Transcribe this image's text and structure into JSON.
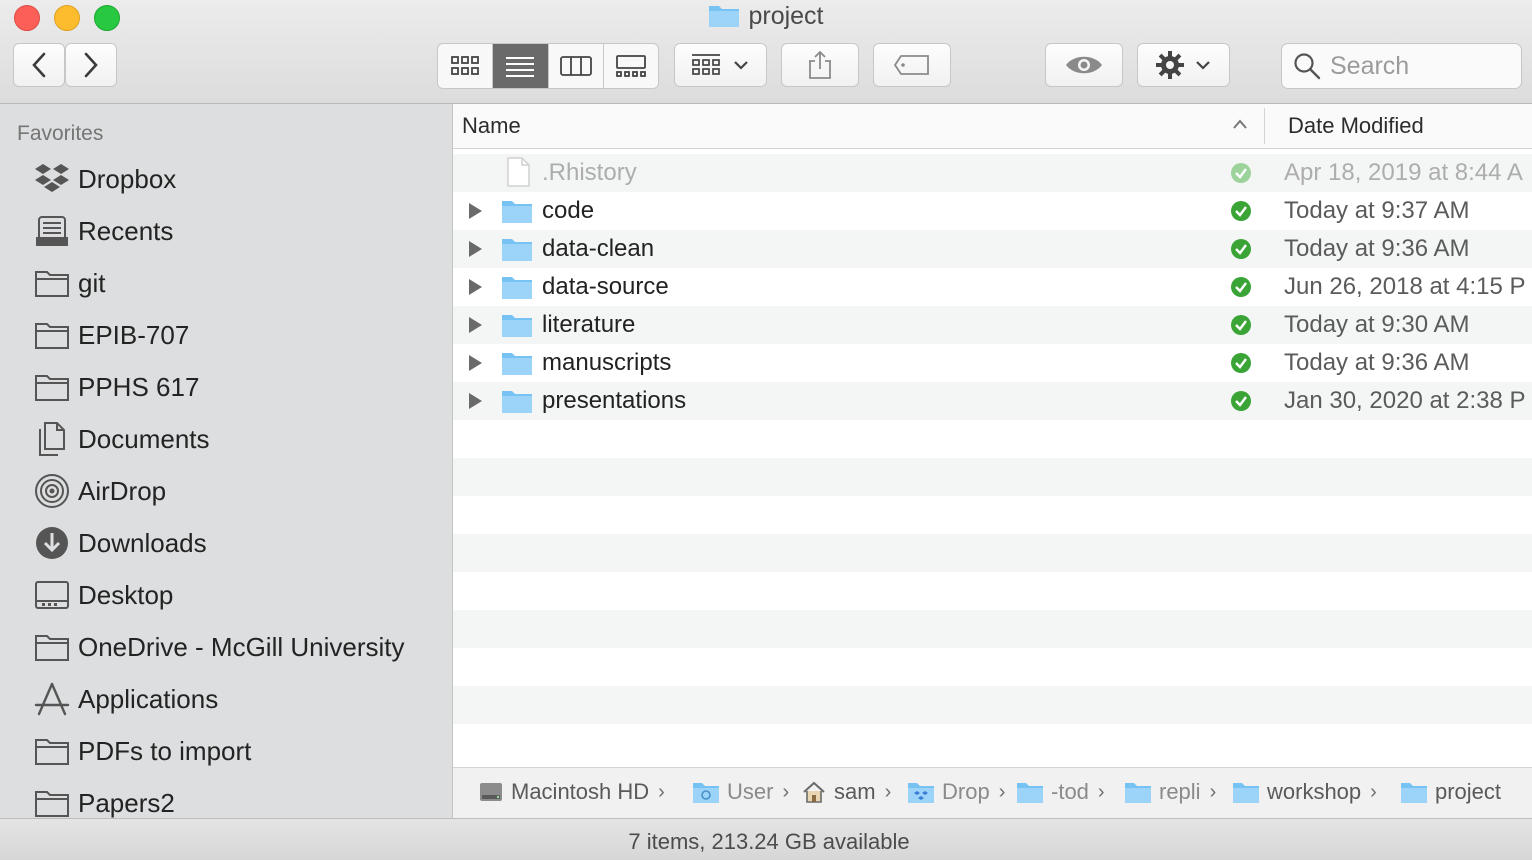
{
  "window": {
    "title": "project"
  },
  "toolbar": {
    "back": "back",
    "forward": "forward",
    "views": [
      "icon-view",
      "list-view",
      "column-view",
      "gallery-view"
    ],
    "active_view": "list-view",
    "search_placeholder": "Search"
  },
  "sidebar": {
    "heading": "Favorites",
    "items": [
      {
        "label": "Dropbox",
        "icon": "dropbox-icon"
      },
      {
        "label": "Recents",
        "icon": "recents-icon"
      },
      {
        "label": "git",
        "icon": "folder-icon"
      },
      {
        "label": "EPIB-707",
        "icon": "folder-icon"
      },
      {
        "label": "PPHS 617",
        "icon": "folder-icon"
      },
      {
        "label": "Documents",
        "icon": "documents-icon"
      },
      {
        "label": "AirDrop",
        "icon": "airdrop-icon"
      },
      {
        "label": "Downloads",
        "icon": "downloads-icon"
      },
      {
        "label": "Desktop",
        "icon": "desktop-icon"
      },
      {
        "label": "OneDrive - McGill University",
        "icon": "folder-icon"
      },
      {
        "label": "Applications",
        "icon": "applications-icon"
      },
      {
        "label": "PDFs to import",
        "icon": "folder-icon"
      },
      {
        "label": "Papers2",
        "icon": "folder-icon"
      }
    ]
  },
  "list": {
    "col_name": "Name",
    "col_date": "Date Modified",
    "rows": [
      {
        "name": ".Rhistory",
        "date": "Apr 18, 2019 at 8:44 A",
        "kind": "file",
        "dim": true
      },
      {
        "name": "code",
        "date": "Today at 9:37 AM",
        "kind": "folder"
      },
      {
        "name": "data-clean",
        "date": "Today at 9:36 AM",
        "kind": "folder"
      },
      {
        "name": "data-source",
        "date": "Jun 26, 2018 at 4:15 P",
        "kind": "folder"
      },
      {
        "name": "literature",
        "date": "Today at 9:30 AM",
        "kind": "folder"
      },
      {
        "name": "manuscripts",
        "date": "Today at 9:36 AM",
        "kind": "folder"
      },
      {
        "name": "presentations",
        "date": "Jan 30, 2020 at 2:38 P",
        "kind": "folder"
      }
    ]
  },
  "pathbar": {
    "crumbs": [
      {
        "label": "Macintosh HD",
        "icon": "hard-drive-icon"
      },
      {
        "label": "User",
        "icon": "users-folder-icon"
      },
      {
        "label": "sam",
        "icon": "home-icon"
      },
      {
        "label": "Drop",
        "icon": "dropbox-folder-icon"
      },
      {
        "label": "-tod",
        "icon": "folder-icon"
      },
      {
        "label": "repli",
        "icon": "folder-icon"
      },
      {
        "label": "workshop",
        "icon": "folder-icon"
      },
      {
        "label": "project",
        "icon": "folder-icon"
      }
    ]
  },
  "status": {
    "text": "7 items, 213.24 GB available"
  },
  "colors": {
    "folder": "#8fd0f7",
    "sync_check": "#3aa536",
    "active_segment": "#6a6a6a"
  }
}
